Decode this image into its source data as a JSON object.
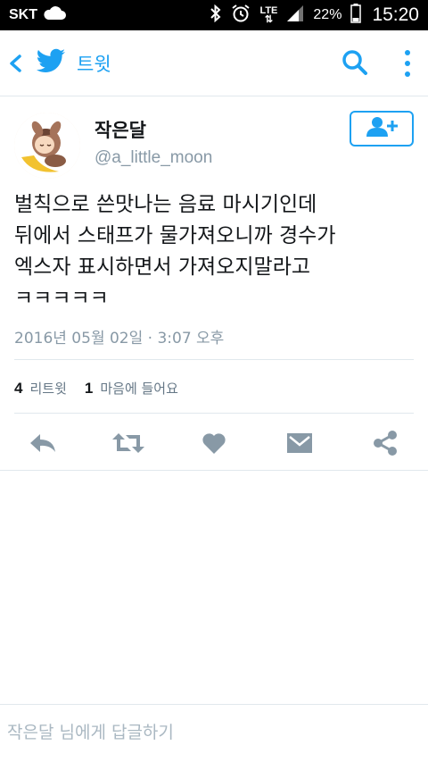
{
  "status_bar": {
    "carrier": "SKT",
    "network": "LTE",
    "battery": "22%",
    "time": "15:20",
    "icons": [
      "cloud-icon",
      "bluetooth-icon",
      "alarm-icon",
      "signal-icon",
      "battery-icon"
    ]
  },
  "app_bar": {
    "title": "트윗",
    "icons": [
      "back-icon",
      "twitter-bird-icon",
      "search-icon",
      "more-icon"
    ]
  },
  "colors": {
    "accent": "#1da1f2",
    "action_gray": "#8899a6",
    "text": "#14171a",
    "muted": "#8899a6"
  },
  "tweet": {
    "author_name": "작은달",
    "author_handle": "@a_little_moon",
    "text": "벌칙으로 쓴맛나는 음료 마시기인데\n뒤에서 스태프가 물가져오니까 경수가\n엑스자 표시하면서 가져오지말라고\nㅋㅋㅋㅋㅋ",
    "timestamp": "2016년 05월 02일 · 3:07 오후",
    "retweet_count": "4",
    "retweet_label": "리트윗",
    "like_count": "1",
    "like_label": "마음에 들어요"
  },
  "actions": [
    "reply-icon",
    "retweet-icon",
    "heart-icon",
    "message-icon",
    "share-icon"
  ],
  "reply": {
    "placeholder": "작은달 님에게 답글하기"
  }
}
